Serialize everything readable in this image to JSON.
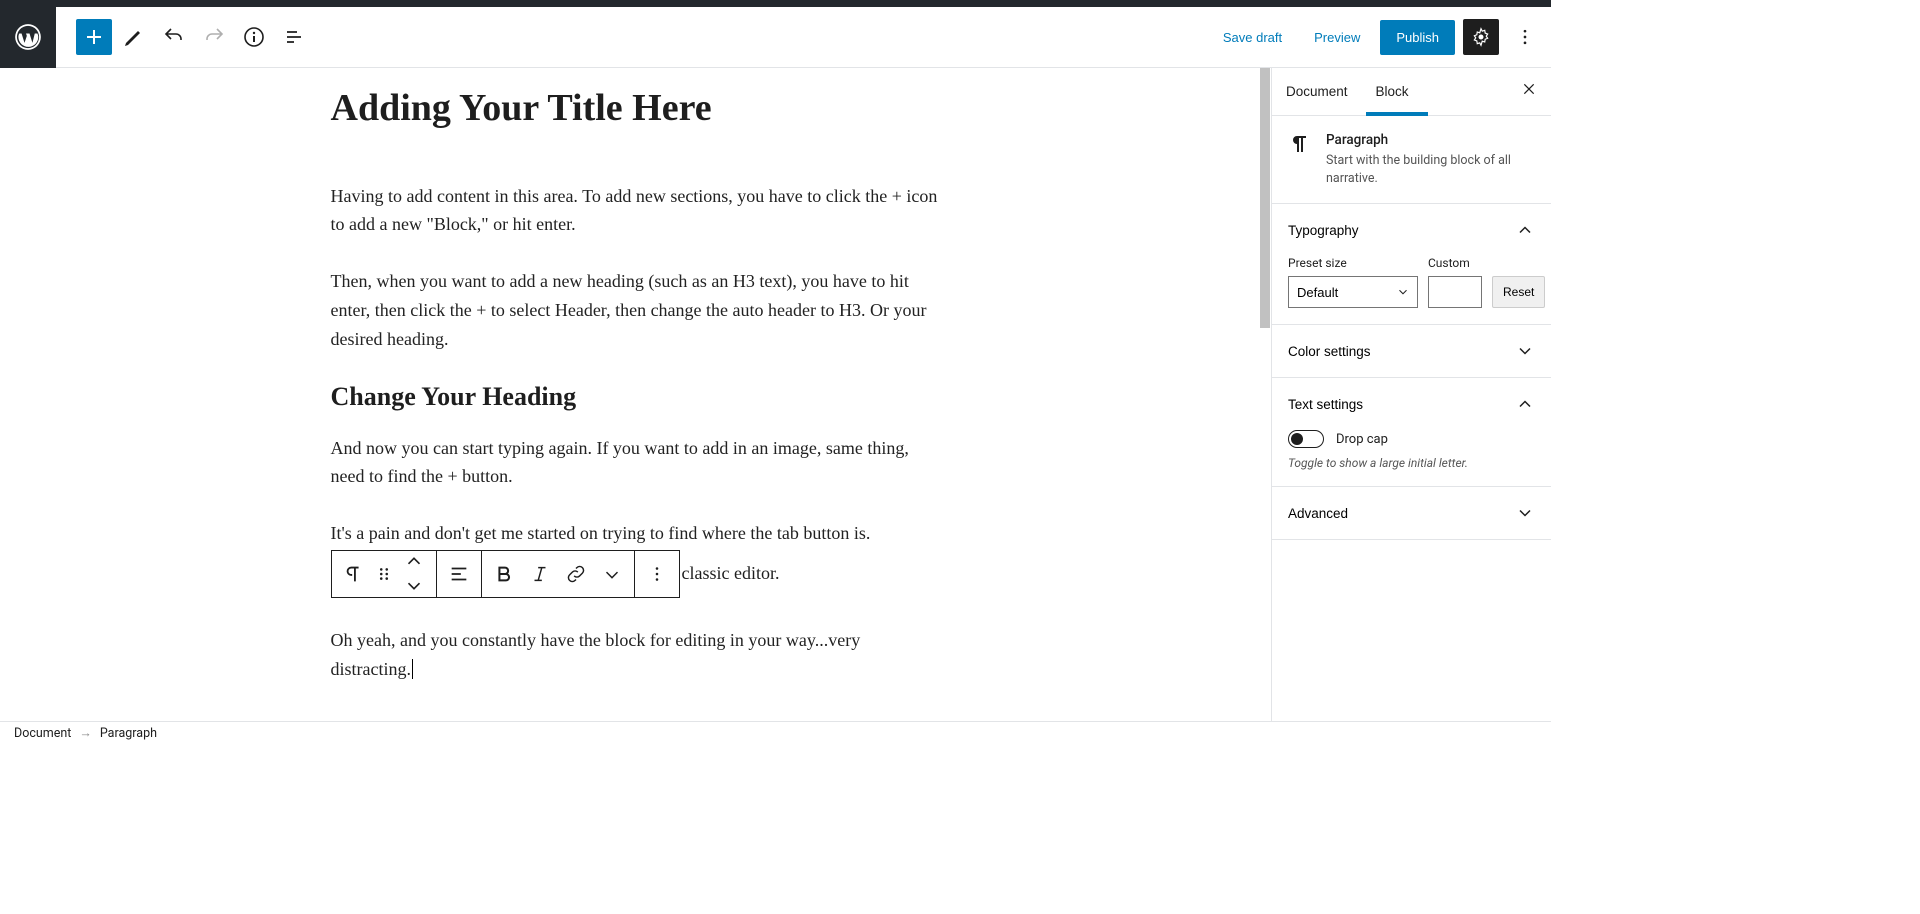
{
  "toolbar": {
    "save_draft": "Save draft",
    "preview": "Preview",
    "publish": "Publish"
  },
  "post": {
    "title": "Adding Your Title Here",
    "p1": "Having to add content in this area. To add new sections, you have to click the + icon to add a new \"Block,\" or hit enter.",
    "p2": "Then, when you want to add a new heading (such as an H3 text), you have to hit enter, then click the + to select Header, then change the auto header to H3. Or your desired heading.",
    "h3": "Change Your Heading",
    "p3": "And now you can start typing again. If you want to add in an image, same thing, need to find the + button.",
    "p4": "It's a pain and don't get me started on trying to find where the tab button is.",
    "p4b": "classic editor.",
    "p5": "Oh yeah, and you constantly have the block for editing in your way...very distracting."
  },
  "sidebar": {
    "tab_document": "Document",
    "tab_block": "Block",
    "block_name": "Paragraph",
    "block_desc": "Start with the building block of all narrative.",
    "typography": {
      "title": "Typography",
      "preset_label": "Preset size",
      "preset_value": "Default",
      "custom_label": "Custom",
      "reset": "Reset"
    },
    "color_settings": "Color settings",
    "text_settings": {
      "title": "Text settings",
      "drop_cap": "Drop cap",
      "drop_cap_help": "Toggle to show a large initial letter."
    },
    "advanced": "Advanced"
  },
  "breadcrumb": {
    "doc": "Document",
    "block": "Paragraph"
  }
}
